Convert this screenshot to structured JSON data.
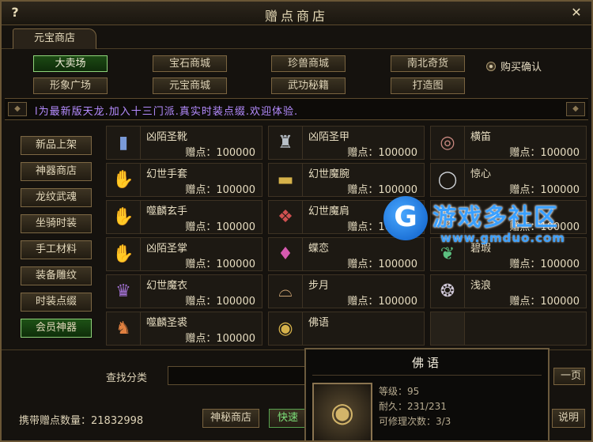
{
  "window": {
    "title": "赠点商店",
    "help_label": "?",
    "close_label": "✕"
  },
  "tab": {
    "label": "元宝商店"
  },
  "top_buttons": [
    {
      "label": "大卖场",
      "active": true
    },
    {
      "label": "宝石商城"
    },
    {
      "label": "珍兽商城"
    },
    {
      "label": "南北奇货"
    },
    {
      "label": "形象广场"
    },
    {
      "label": "元宝商城"
    },
    {
      "label": "武功秘籍"
    },
    {
      "label": "打造图"
    }
  ],
  "confirm": {
    "label": "购买确认"
  },
  "banner": {
    "text": "l为最新版天龙.加入十三门派.真实时装点缀.欢迎体验."
  },
  "categories": [
    {
      "label": "新品上架"
    },
    {
      "label": "神器商店"
    },
    {
      "label": "龙纹武魂"
    },
    {
      "label": "坐骑时装"
    },
    {
      "label": "手工材料"
    },
    {
      "label": "装备雕纹"
    },
    {
      "label": "时装点缀"
    },
    {
      "label": "会员神器",
      "active": true
    }
  ],
  "items": [
    {
      "name": "凶陌圣靴",
      "price": "赠点：100000",
      "icon": "boots-icon"
    },
    {
      "name": "凶陌圣甲",
      "price": "赠点：100000",
      "icon": "armor-icon"
    },
    {
      "name": "横笛",
      "price": "赠点：100000",
      "icon": "ring-icon"
    },
    {
      "name": "幻世手套",
      "price": "赠点：100000",
      "icon": "gauntlet-icon"
    },
    {
      "name": "幻世魔腕",
      "price": "赠点：100000",
      "icon": "bracer-icon"
    },
    {
      "name": "惊心",
      "price": "赠点：100000",
      "icon": "ring-icon"
    },
    {
      "name": "噬麟玄手",
      "price": "赠点：100000",
      "icon": "gauntlet-icon"
    },
    {
      "name": "幻世魔肩",
      "price": "赠点：100000",
      "icon": "shoulder-icon"
    },
    {
      "name": "",
      "price": "赠点：100000",
      "icon": "pendant-icon"
    },
    {
      "name": "凶陌圣掌",
      "price": "赠点：100000",
      "icon": "gauntlet-icon"
    },
    {
      "name": "蝶恋",
      "price": "赠点：100000",
      "icon": "amulet-icon"
    },
    {
      "name": "碧瑕",
      "price": "赠点：100000",
      "icon": "jade-icon"
    },
    {
      "name": "幻世魔衣",
      "price": "赠点：100000",
      "icon": "robe-icon"
    },
    {
      "name": "步月",
      "price": "赠点：100000",
      "icon": "belt-icon"
    },
    {
      "name": "浅浪",
      "price": "赠点：100000",
      "icon": "bead-icon"
    },
    {
      "name": "噬麟圣裘",
      "price": "赠点：100000",
      "icon": "beast-armor-icon"
    },
    {
      "name": "佛语",
      "price": "",
      "icon": "gold-ring-icon"
    },
    {
      "name": "",
      "price": "",
      "icon": "empty-slot"
    }
  ],
  "search": {
    "label": "查找分类",
    "value": ""
  },
  "next_page": {
    "label": "一页"
  },
  "footer": {
    "points_label": "携带赠点数量：21832998",
    "mystery_shop": "神秘商店",
    "quick": "快速",
    "help": "说明"
  },
  "tooltip": {
    "title": "佛语",
    "level": "等级：95",
    "durability": "耐久：231/231",
    "repairs": "可修理次数：3/3"
  },
  "watermark": {
    "name": "游戏多社区",
    "url": "www.gmduo.com"
  }
}
